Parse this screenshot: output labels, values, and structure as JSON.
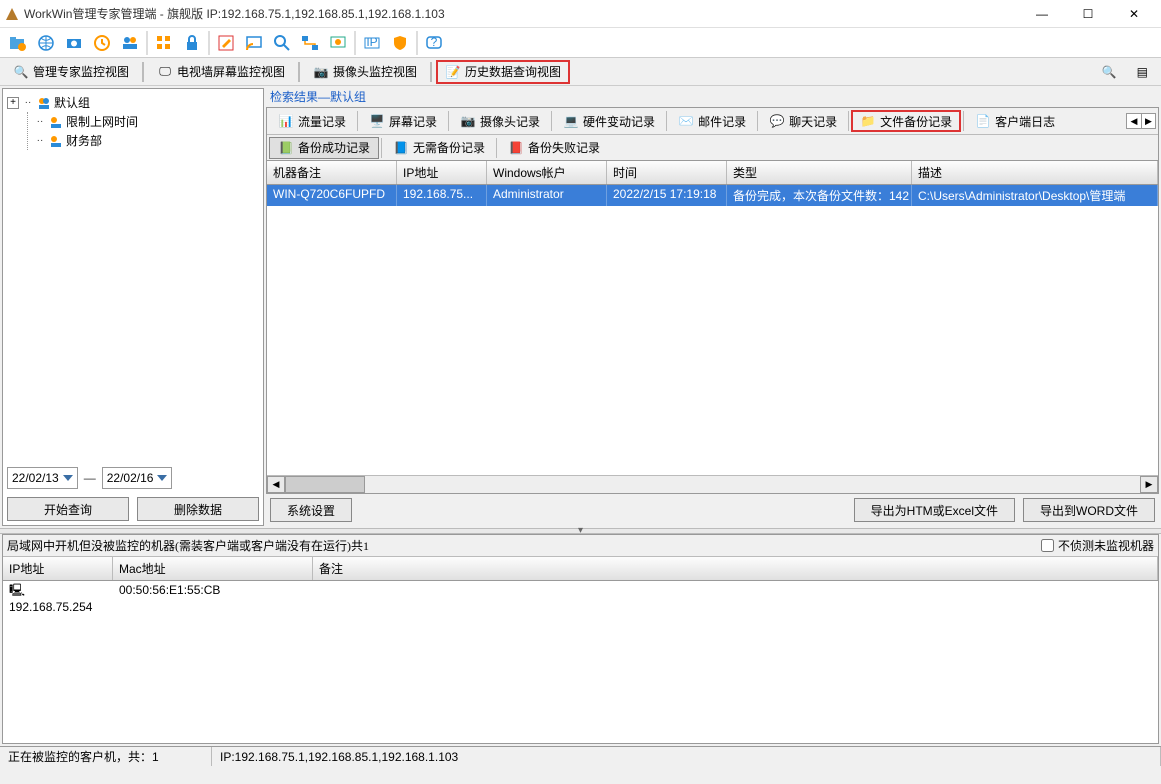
{
  "title": "WorkWin管理专家管理端 - 旗舰版 IP:192.168.75.1,192.168.85.1,192.168.1.103",
  "views": {
    "v1": "管理专家监控视图",
    "v2": "电视墙屏幕监控视图",
    "v3": "摄像头监控视图",
    "v4": "历史数据查询视图"
  },
  "tree": {
    "root": "默认组",
    "child1": "限制上网时间",
    "child2": "财务部"
  },
  "dates": {
    "from": "22/02/13",
    "to": "22/02/16",
    "sep": "—"
  },
  "btns": {
    "search": "开始查询",
    "delete": "删除数据"
  },
  "searchLine": "检索结果—默认组",
  "tabs1": {
    "flow": "流量记录",
    "screen": "屏幕记录",
    "camera": "摄像头记录",
    "hw": "硬件变动记录",
    "mail": "邮件记录",
    "chat": "聊天记录",
    "file": "文件备份记录",
    "clientlog": "客户端日志"
  },
  "tabs2": {
    "ok": "备份成功记录",
    "noneed": "无需备份记录",
    "fail": "备份失败记录"
  },
  "grid": {
    "cols": {
      "c1": "机器备注",
      "c2": "IP地址",
      "c3": "Windows帐户",
      "c4": "时间",
      "c5": "类型",
      "c6": "描述"
    },
    "row": {
      "c1": "WIN-Q720C6FUPFD",
      "c2": "192.168.75...",
      "c3": "Administrator",
      "c4": "2022/2/15 17:19:18",
      "c5": "备份完成，本次备份文件数：142",
      "c6": "C:\\Users\\Administrator\\Desktop\\管理端"
    }
  },
  "bottom": {
    "sys": "系统设置",
    "export1": "导出为HTM或Excel文件",
    "export2": "导出到WORD文件"
  },
  "lower": {
    "title": "局域网中开机但没被监控的机器(需装客户端或客户端没有在运行)共1",
    "chk": "不侦测未监视机器",
    "cols": {
      "ip": "IP地址",
      "mac": "Mac地址",
      "note": "备注"
    },
    "row": {
      "ip": "192.168.75.254",
      "mac": "00:50:56:E1:55:CB",
      "note": ""
    }
  },
  "status": {
    "s1": "正在被监控的客户机，共：1",
    "s2": "IP:192.168.75.1,192.168.85.1,192.168.1.103"
  }
}
